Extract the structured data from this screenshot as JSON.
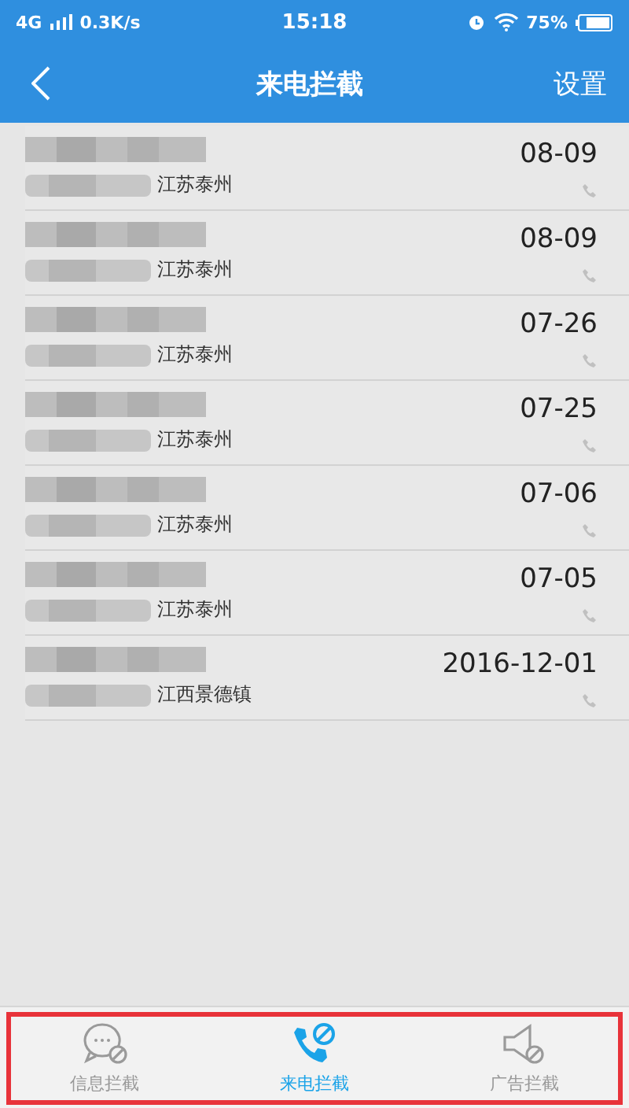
{
  "status_bar": {
    "network": "4G",
    "speed": "0.3K/s",
    "time": "15:18",
    "battery": "75%"
  },
  "header": {
    "title": "来电拦截",
    "action": "设置"
  },
  "calls": [
    {
      "location": "江苏泰州",
      "date": "08-09"
    },
    {
      "location": "江苏泰州",
      "date": "08-09"
    },
    {
      "location": "江苏泰州",
      "date": "07-26"
    },
    {
      "location": "江苏泰州",
      "date": "07-25"
    },
    {
      "location": "江苏泰州",
      "date": "07-06"
    },
    {
      "location": "江苏泰州",
      "date": "07-05"
    },
    {
      "location": "江西景德镇",
      "date": "2016-12-01"
    }
  ],
  "tabs": [
    {
      "kind": "message",
      "label": "信息拦截",
      "selected": false
    },
    {
      "kind": "phone",
      "label": "来电拦截",
      "selected": true
    },
    {
      "kind": "speaker",
      "label": "广告拦截",
      "selected": false
    }
  ]
}
